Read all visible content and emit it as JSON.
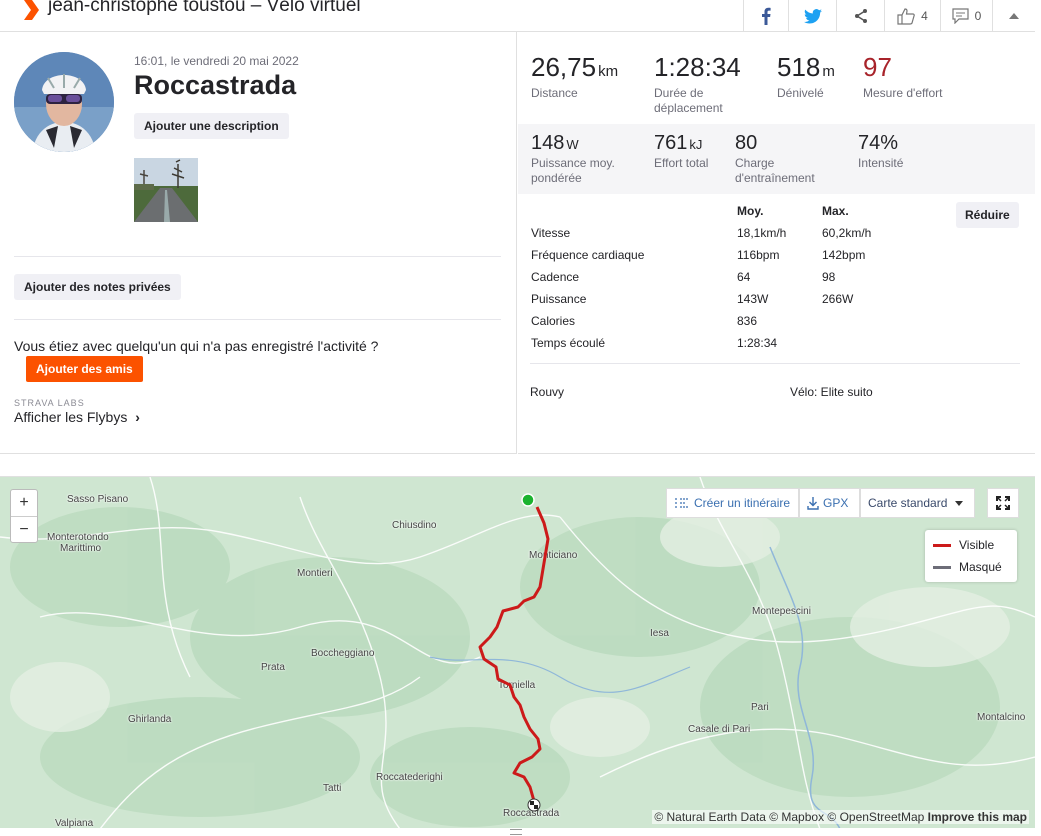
{
  "header": {
    "title": "jean-christophe toustou – Vélo virtuel",
    "kudos_count": "4",
    "comments_count": "0"
  },
  "activity": {
    "datetime": "16:01, le vendredi 20 mai 2022",
    "title": "Roccastrada",
    "add_description": "Ajouter une description",
    "add_private_notes": "Ajouter des notes privées",
    "question": "Vous étiez avec quelqu'un qui n'a pas enregistré l'activité ?",
    "add_friends": "Ajouter des amis",
    "labs": "STRAVA LABS",
    "flybys": "Afficher les Flybys"
  },
  "stats": {
    "distance": {
      "value": "26,75",
      "unit": "km",
      "label": "Distance"
    },
    "moving_time": {
      "value": "1:28:34",
      "label": "Durée de déplacement"
    },
    "elevation": {
      "value": "518",
      "unit": "m",
      "label": "Dénivelé"
    },
    "effort": {
      "value": "97",
      "label": "Mesure d'effort"
    },
    "power": {
      "value": "148",
      "unit": "W",
      "label": "Puissance moy. pondérée"
    },
    "work": {
      "value": "761",
      "unit": "kJ",
      "label": "Effort total"
    },
    "training_load": {
      "value": "80",
      "label": "Charge d'entraînement"
    },
    "intensity": {
      "value": "74%",
      "label": "Intensité"
    }
  },
  "metrics": {
    "head_avg": "Moy.",
    "head_max": "Max.",
    "reduce": "Réduire",
    "rows": [
      {
        "name": "Vitesse",
        "avg": "18,1km/h",
        "max": "60,2km/h"
      },
      {
        "name": "Fréquence cardiaque",
        "avg": "116bpm",
        "max": "142bpm"
      },
      {
        "name": "Cadence",
        "avg": "64",
        "max": "98"
      },
      {
        "name": "Puissance",
        "avg": "143W",
        "max": "266W"
      },
      {
        "name": "Calories",
        "avg": "836",
        "max": ""
      },
      {
        "name": "Temps écoulé",
        "avg": "1:28:34",
        "max": ""
      }
    ],
    "device": "Rouvy",
    "bike": "Vélo: Elite suito"
  },
  "map": {
    "create_route": "Créer un itinéraire",
    "gpx": "GPX",
    "map_style": "Carte standard",
    "legend_visible": "Visible",
    "legend_hidden": "Masqué",
    "route_color": "#cc1a1a",
    "hidden_color": "#6d6d78",
    "attribution": "© Natural Earth Data © Mapbox © OpenStreetMap",
    "improve": "Improve this map",
    "places": {
      "sasso_pisano": "Sasso Pisano",
      "monterotondo": "Monterotondo",
      "marittimo": "Marittimo",
      "chiusdino": "Chiusdino",
      "monticiano": "Monticiano",
      "montieri": "Montieri",
      "montepescini": "Montepescini",
      "iesa": "Iesa",
      "boccheggiano": "Boccheggiano",
      "prata": "Prata",
      "torniella": "Torniella",
      "ghirlanda": "Ghirlanda",
      "pari": "Pari",
      "casale_di_pari": "Casale di Pari",
      "montalcino": "Montalcino",
      "roccatederighi": "Roccatederighi",
      "tatti": "Tatti",
      "roccastrada": "Roccastrada",
      "valpiana": "Valpiana"
    }
  }
}
